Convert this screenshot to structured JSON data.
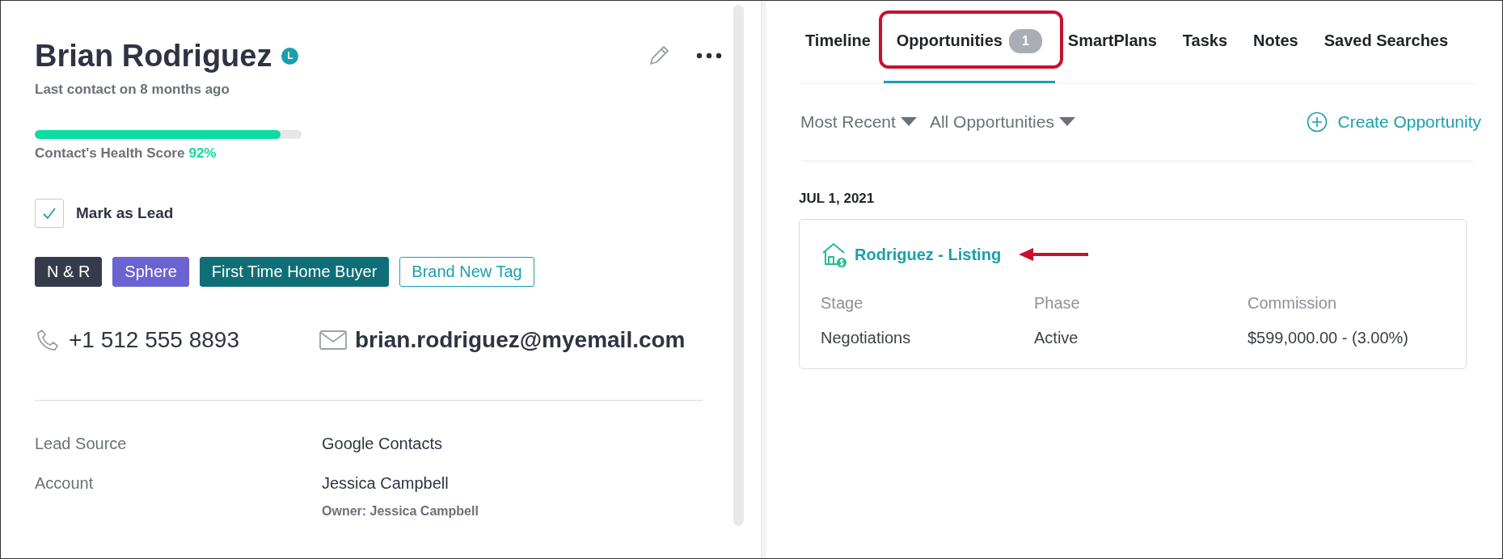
{
  "contact": {
    "name": "Brian Rodriguez",
    "badge": "L",
    "last_contact": "Last contact on 8 months ago",
    "health": {
      "label": "Contact's Health Score",
      "value": "92%",
      "level": 0.92
    },
    "mark_as_lead": {
      "label": "Mark as Lead",
      "checked": true
    },
    "tags": [
      {
        "label": "N & R",
        "kind": "filled",
        "color": "#363b4c"
      },
      {
        "label": "Sphere",
        "kind": "filled",
        "color": "#6b63d1"
      },
      {
        "label": "First Time Home Buyer",
        "kind": "filled",
        "color": "#106f76"
      },
      {
        "label": "Brand New Tag",
        "kind": "outline",
        "color": "#1a9fae"
      }
    ],
    "phone": "+1 512 555 8893",
    "email": "brian.rodriguez@myemail.com",
    "fields": [
      {
        "label": "Lead Source",
        "value": "Google Contacts"
      },
      {
        "label": "Account",
        "value": "Jessica Campbell",
        "note": "Owner: Jessica Campbell"
      }
    ]
  },
  "tabs": [
    {
      "label": "Timeline",
      "selected": false,
      "highlighted": false
    },
    {
      "label": "Opportunities",
      "count": "1",
      "selected": true,
      "highlighted": true
    },
    {
      "label": "SmartPlans",
      "selected": false,
      "highlighted": false
    },
    {
      "label": "Tasks",
      "selected": false,
      "highlighted": false
    },
    {
      "label": "Notes",
      "selected": false,
      "highlighted": false
    },
    {
      "label": "Saved Searches",
      "selected": false,
      "highlighted": false
    }
  ],
  "filters": [
    {
      "label": "Most Recent"
    },
    {
      "label": "All Opportunities"
    }
  ],
  "create_button": "Create Opportunity",
  "groups": [
    {
      "date": "JUL 1, 2021",
      "cards": [
        {
          "title": "Rodriguez - Listing",
          "pointed": true,
          "columns": [
            {
              "label": "Stage",
              "value": "Negotiations"
            },
            {
              "label": "Phase",
              "value": "Active"
            },
            {
              "label": "Commission",
              "value": "$599,000.00 - (3.00%)"
            }
          ]
        }
      ]
    }
  ]
}
